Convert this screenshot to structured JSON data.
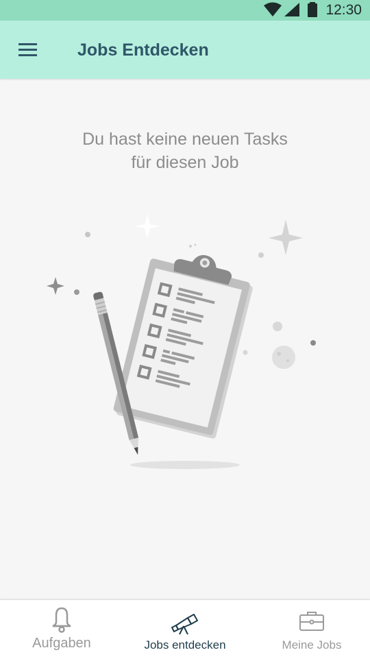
{
  "status_bar": {
    "time": "12:30",
    "background_color": "#8fdcbe",
    "icons": [
      "wifi-icon",
      "cell-signal-icon",
      "battery-icon"
    ]
  },
  "app_bar": {
    "title": "Jobs Entdecken",
    "background_color": "#b7efde",
    "title_color": "#2f5668",
    "menu_icon": "hamburger-menu-icon"
  },
  "main": {
    "empty_message_line1": "Du hast keine neuen Tasks",
    "empty_message_line2": "für diesen Job",
    "illustration": "clipboard-with-pencil-illustration"
  },
  "bottom_nav": {
    "items": [
      {
        "label": "Aufgaben",
        "icon": "bell-icon",
        "active": false
      },
      {
        "label": "Jobs entdecken",
        "icon": "telescope-icon",
        "active": true
      },
      {
        "label": "Meine Jobs",
        "icon": "briefcase-icon",
        "active": false
      }
    ],
    "active_color": "#1f3d4a",
    "inactive_color": "#9a9a9a"
  }
}
